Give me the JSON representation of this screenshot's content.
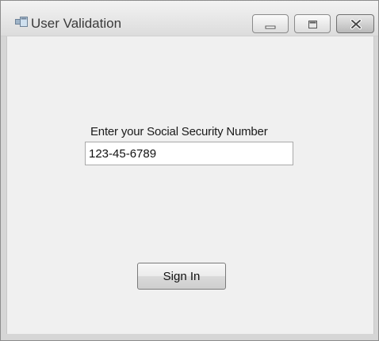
{
  "window": {
    "title": "User Validation",
    "icon": "form-window-icon",
    "controls": {
      "minimize": "minimize-icon",
      "maximize": "maximize-icon",
      "close": "close-icon"
    }
  },
  "form": {
    "ssn_label": "Enter your Social Security Number",
    "ssn_value": "123-45-6789",
    "sign_in_label": "Sign In"
  }
}
